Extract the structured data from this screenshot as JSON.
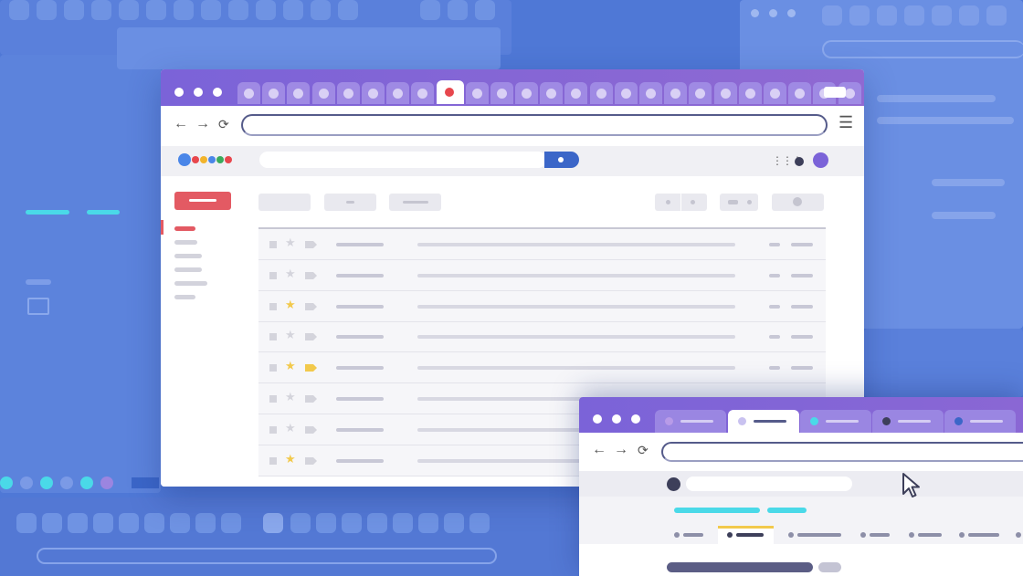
{
  "colors": {
    "background": "#4f78d6",
    "titlebar": "#7b63d8",
    "accent_red": "#e35a63",
    "star_yellow": "#f2c94c",
    "search_button": "#3b66c8",
    "cyan": "#4ad9e8"
  },
  "main_window": {
    "window_controls": [
      "window-dot",
      "window-dot",
      "window-dot"
    ],
    "tab_count": 25,
    "active_tab_index": 8,
    "nav_icons": [
      "back-arrow-icon",
      "forward-arrow-icon",
      "reload-icon",
      "menu-icon"
    ],
    "glyphs": {
      "back": "←",
      "forward": "→",
      "reload": "⟳",
      "menu": "☰",
      "apps": "⋮⋮⋮",
      "star": "★"
    },
    "logo_dots": [
      "#4a86e8",
      "#e8474d",
      "#f2b42c",
      "#4a86e8",
      "#3aaa5c",
      "#e8474d"
    ],
    "email_rows": [
      {
        "starred": false,
        "tagged": false
      },
      {
        "starred": false,
        "tagged": false
      },
      {
        "starred": true,
        "tagged": false
      },
      {
        "starred": false,
        "tagged": false
      },
      {
        "starred": true,
        "tagged": true
      },
      {
        "starred": false,
        "tagged": false
      },
      {
        "starred": false,
        "tagged": false
      },
      {
        "starred": true,
        "tagged": false
      }
    ],
    "sidebar_items": 6
  },
  "second_window": {
    "tabs": [
      {
        "icon_color": "#b89be8",
        "active": false
      },
      {
        "icon_color": "#c9c2f0",
        "active": true
      },
      {
        "icon_color": "#4ad9e8",
        "active": false
      },
      {
        "icon_color": "#3d3f5a",
        "active": false
      },
      {
        "icon_color": "#3b66c8",
        "active": false
      }
    ]
  }
}
